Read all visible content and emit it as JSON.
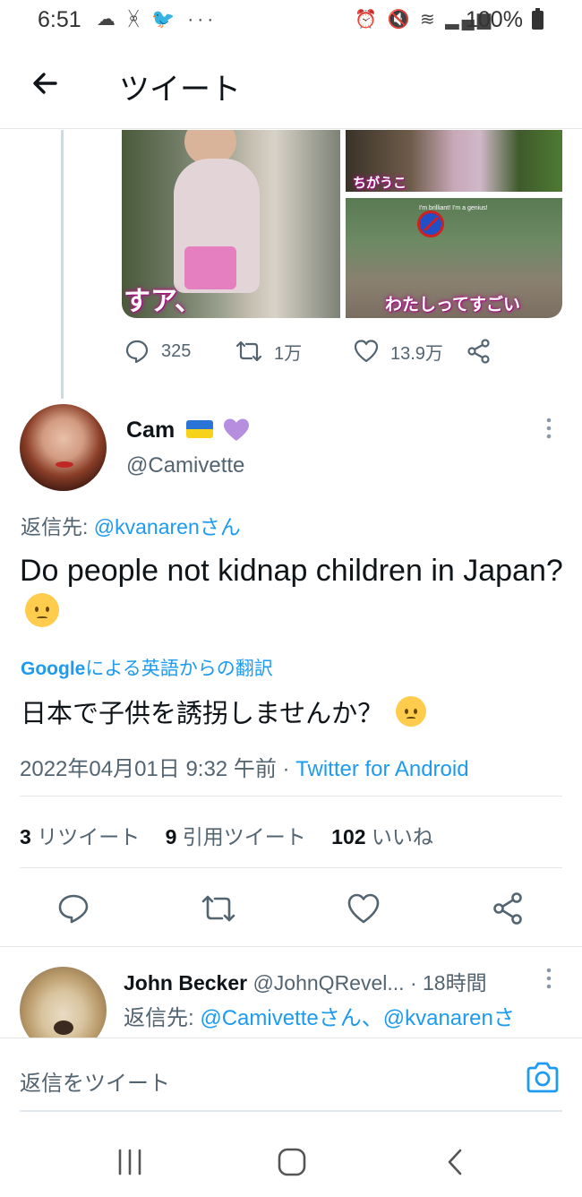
{
  "status_bar": {
    "time": "6:51",
    "left_icons": [
      "weather-icon",
      "app-icon",
      "twitter-bird-icon",
      "more-dots-icon"
    ],
    "right_icons": [
      "alarm-icon",
      "mute-icon",
      "wifi-icon",
      "signal-icon"
    ],
    "battery": "100%"
  },
  "header": {
    "title": "ツイート"
  },
  "previous_tweet": {
    "media_captions": [
      "すア、",
      "ちがうこ",
      "わたしってすごい"
    ],
    "media_small_caption": "I'm brilliant! I'm a genius!",
    "replies": "325",
    "retweets": "1万",
    "likes": "13.9万"
  },
  "tweet": {
    "author_name": "Cam",
    "author_handle": "@Camivette",
    "reply_prefix": "返信先: ",
    "reply_mention": "@kvanarenさん",
    "text": "Do people not kidnap children in Japan?",
    "translate_google": "Google",
    "translate_label": "による英語からの翻訳",
    "translated_text": "日本で子供を誘拐しませんか？",
    "date": "2022年04月01日 9:32 午前",
    "separator": " · ",
    "source": "Twitter for Android"
  },
  "stats": {
    "retweets_count": "3",
    "retweets_label": "リツイート",
    "quotes_count": "9",
    "quotes_label": "引用ツイート",
    "likes_count": "102",
    "likes_label": "いいね"
  },
  "reply": {
    "name": "John Becker",
    "handle": "@JohnQRevel...",
    "time": "· 18時間",
    "reply_prefix": "返信先: ",
    "mentions": "@Camivetteさん、@kvanarenさ"
  },
  "compose": {
    "placeholder": "返信をツイート"
  },
  "colors": {
    "accent": "#1d9bf0",
    "secondary_text": "#536471",
    "primary_text": "#0f1419"
  }
}
